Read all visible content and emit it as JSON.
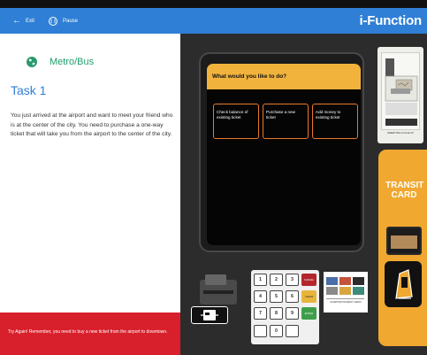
{
  "header": {
    "exit_icon": "arrow-left-icon",
    "exit_label": "Exit",
    "pause_icon": "pause-icon",
    "pause_label": "Pause",
    "logo_text": "i-Function",
    "color": "#2f7fd6"
  },
  "task": {
    "category_icon": "globe-icon",
    "category": "Metro/Bus",
    "title": "Task 1",
    "description": "You just arrived at the airport and want to meet your friend who is at the center of the city. You need to purchase a one-way ticket that will take you from the airport to the center of the city.",
    "hint": "Try Again! Remember, you need to buy a new ticket from the airport to downtown."
  },
  "screen": {
    "prompt": "What would you like to do?",
    "options": [
      "Check balance of existing ticket",
      "Purchase a new ticket",
      "Add money to existing ticket"
    ]
  },
  "ticket_slot": {
    "label": "INSERT BILLS FACE UP"
  },
  "transit_card": {
    "line1": "TRANSIT",
    "line2": "CARD"
  },
  "keypad": {
    "keys": [
      "1",
      "2",
      "3",
      "4",
      "5",
      "6",
      "7",
      "8",
      "9",
      "0"
    ],
    "cancel": "CANCEL",
    "clear": "CLEAR",
    "enter": "ENTER"
  },
  "payment": {
    "caption": "ACCEPTED PAYMENT CARDS"
  },
  "colors": {
    "accent_blue": "#2f7fd6",
    "category_green": "#1f9e6c",
    "error_red": "#d8202c",
    "prompt_yellow": "#f2b33d",
    "panel_orange": "#f0a830"
  }
}
